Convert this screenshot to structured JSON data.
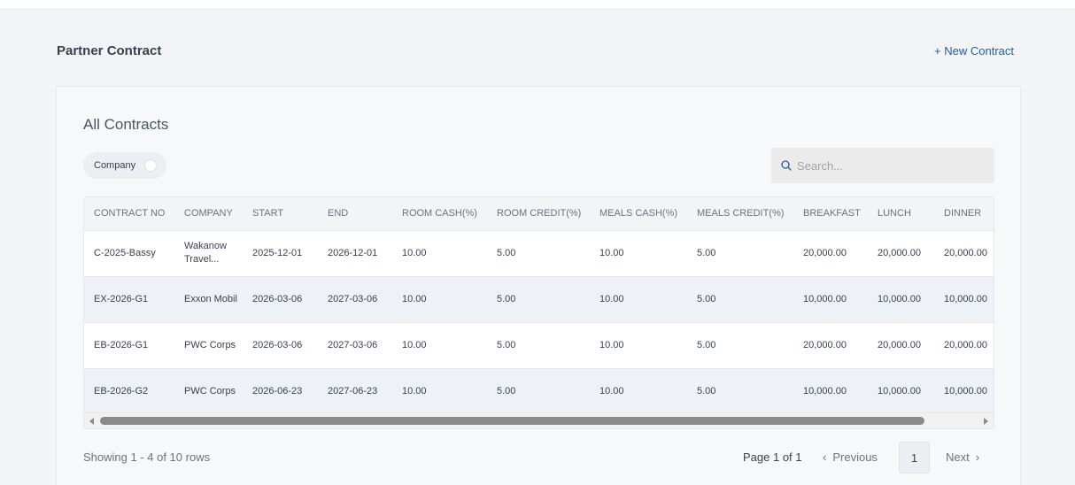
{
  "page": {
    "title": "Partner Contract",
    "new_contract_label": "+ New Contract"
  },
  "card": {
    "title": "All Contracts",
    "filter_label": "Company",
    "search": {
      "placeholder": "Search...",
      "value": ""
    }
  },
  "table": {
    "columns": [
      "CONTRACT NO",
      "COMPANY",
      "START",
      "END",
      "ROOM CASH(%)",
      "ROOM CREDIT(%)",
      "MEALS CASH(%)",
      "MEALS CREDIT(%)",
      "BREAKFAST",
      "LUNCH",
      "DINNER"
    ],
    "rows": [
      [
        "C-2025-Bassy",
        "Wakanow Travel...",
        "2025-12-01",
        "2026-12-01",
        "10.00",
        "5.00",
        "10.00",
        "5.00",
        "20,000.00",
        "20,000.00",
        "20,000.00"
      ],
      [
        "EX-2026-G1",
        "Exxon Mobil",
        "2026-03-06",
        "2027-03-06",
        "10.00",
        "5.00",
        "10.00",
        "5.00",
        "10,000.00",
        "10,000.00",
        "10,000.00"
      ],
      [
        "EB-2026-G1",
        "PWC Corps",
        "2026-03-06",
        "2027-03-06",
        "10.00",
        "5.00",
        "10.00",
        "5.00",
        "20,000.00",
        "20,000.00",
        "20,000.00"
      ],
      [
        "EB-2026-G2",
        "PWC Corps",
        "2026-06-23",
        "2027-06-23",
        "10.00",
        "5.00",
        "10.00",
        "5.00",
        "10,000.00",
        "10,000.00",
        "10,000.00"
      ]
    ]
  },
  "footer": {
    "showing_text": "Showing 1 - 4 of 10 rows",
    "page_text": "Page 1 of 1",
    "prev_label": "Previous",
    "current_page": "1",
    "next_label": "Next"
  },
  "icons": {
    "search": "search-icon",
    "prev": "chevron-left-icon",
    "next": "chevron-right-icon"
  },
  "colors": {
    "accent": "#1d5fa8",
    "row_alt": "#eef1f5"
  }
}
